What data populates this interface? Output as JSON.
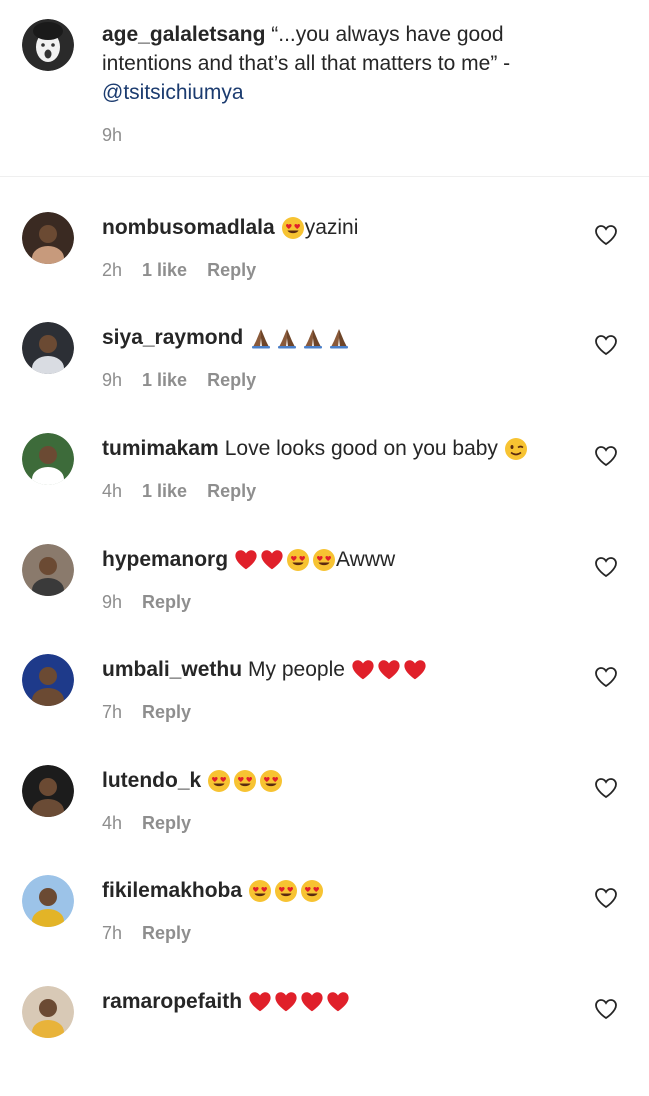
{
  "caption": {
    "username": "age_galaletsang",
    "text": "“...you always have good intentions and that’s all that matters to me” -",
    "mention": "@tsitsichiumya",
    "time": "9h",
    "avatar_icon": "profile-photo"
  },
  "comments": [
    {
      "username": "nombusomadlala",
      "text": "yazini",
      "emojis": [
        "heart-eyes"
      ],
      "emoji_position": "before",
      "time": "2h",
      "likes": "1 like",
      "reply": "Reply",
      "avatar_colors": [
        "#3a2a22",
        "#c79a7c"
      ]
    },
    {
      "username": "siya_raymond",
      "text": "",
      "emojis": [
        "folded-hands",
        "folded-hands",
        "folded-hands",
        "folded-hands"
      ],
      "emoji_position": "after",
      "time": "9h",
      "likes": "1 like",
      "reply": "Reply",
      "avatar_colors": [
        "#2c2f35",
        "#d9dce2"
      ]
    },
    {
      "username": "tumimakam",
      "text": "Love looks good on you baby",
      "emojis": [
        "winking-face"
      ],
      "emoji_position": "after",
      "time": "4h",
      "likes": "1 like",
      "reply": "Reply",
      "avatar_colors": [
        "#3d6b3a",
        "#ffffff"
      ]
    },
    {
      "username": "hypemanorg",
      "text": "Awww",
      "emojis": [
        "red-heart",
        "red-heart",
        "heart-eyes",
        "heart-eyes"
      ],
      "emoji_position": "before",
      "time": "9h",
      "likes": "",
      "reply": "Reply",
      "avatar_colors": [
        "#8a7a6c",
        "#3a3a3a"
      ]
    },
    {
      "username": "umbali_wethu",
      "text": "My people",
      "emojis": [
        "red-heart",
        "red-heart",
        "red-heart"
      ],
      "emoji_position": "after",
      "time": "7h",
      "likes": "",
      "reply": "Reply",
      "avatar_colors": [
        "#1e3a8a",
        "#6b4a33"
      ]
    },
    {
      "username": "lutendo_k",
      "text": "",
      "emojis": [
        "heart-eyes",
        "heart-eyes",
        "heart-eyes"
      ],
      "emoji_position": "after",
      "time": "4h",
      "likes": "",
      "reply": "Reply",
      "avatar_colors": [
        "#1c1c1c",
        "#6a4b35"
      ]
    },
    {
      "username": "fikilemakhoba",
      "text": "",
      "emojis": [
        "heart-eyes",
        "heart-eyes",
        "heart-eyes"
      ],
      "emoji_position": "after",
      "time": "7h",
      "likes": "",
      "reply": "Reply",
      "avatar_colors": [
        "#9cc3e8",
        "#e3b427"
      ]
    },
    {
      "username": "ramaropefaith",
      "text": "",
      "emojis": [
        "red-heart",
        "red-heart",
        "red-heart",
        "red-heart"
      ],
      "emoji_position": "after",
      "time": "",
      "likes": "",
      "reply": "",
      "avatar_colors": [
        "#d8c9b6",
        "#e8b33a"
      ]
    }
  ],
  "colors": {
    "username": "#262626",
    "meta": "#8e8e8e",
    "mention": "#1b3b6f",
    "heart_red": "#e0202a"
  }
}
